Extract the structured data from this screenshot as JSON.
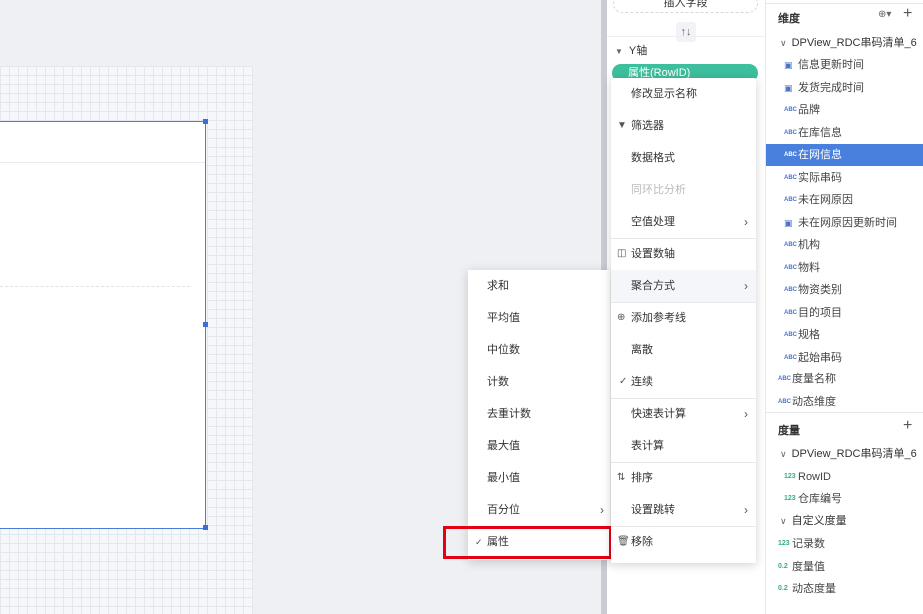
{
  "middle_panel": {
    "insert_field": "插入字段",
    "swap_icon": "↑↓",
    "yaxis_label": "Y轴",
    "pill_label": "属性(RowID)"
  },
  "context_menu": {
    "items": [
      {
        "label": "修改显示名称"
      },
      {
        "label": "筛选器",
        "icon": "filter-icon"
      },
      {
        "label": "数据格式"
      },
      {
        "label": "同环比分析"
      },
      {
        "label": "空值处理"
      },
      {
        "label": "设置数轴",
        "icon": "axis-icon"
      },
      {
        "label": "聚合方式"
      },
      {
        "label": "添加参考线",
        "icon": "add-circle-icon"
      },
      {
        "label": "离散"
      },
      {
        "label": "连续"
      },
      {
        "label": "快速表计算"
      },
      {
        "label": "表计算"
      },
      {
        "label": "排序",
        "icon": "sort-icon"
      },
      {
        "label": "设置跳转"
      },
      {
        "label": "移除",
        "icon": "trash-icon"
      }
    ]
  },
  "aggregation_submenu": {
    "items": [
      {
        "label": "求和"
      },
      {
        "label": "平均值"
      },
      {
        "label": "中位数"
      },
      {
        "label": "计数"
      },
      {
        "label": "去重计数"
      },
      {
        "label": "最大值"
      },
      {
        "label": "最小值"
      },
      {
        "label": "百分位"
      },
      {
        "label": "属性",
        "checked": true
      }
    ]
  },
  "dimensions": {
    "title": "维度",
    "group": "DPView_RDC串码清单_6",
    "items": [
      {
        "label": "信息更新时间",
        "type": "date"
      },
      {
        "label": "发货完成时间",
        "type": "date"
      },
      {
        "label": "品牌",
        "type": "abc"
      },
      {
        "label": "在库信息",
        "type": "abc"
      },
      {
        "label": "在网信息",
        "type": "abc",
        "selected": true
      },
      {
        "label": "实际串码",
        "type": "abc"
      },
      {
        "label": "未在网原因",
        "type": "abc"
      },
      {
        "label": "未在网原因更新时间",
        "type": "date"
      },
      {
        "label": "机构",
        "type": "abc"
      },
      {
        "label": "物料",
        "type": "abc"
      },
      {
        "label": "物资类别",
        "type": "abc"
      },
      {
        "label": "目的项目",
        "type": "abc"
      },
      {
        "label": "规格",
        "type": "abc"
      },
      {
        "label": "起始串码",
        "type": "abc"
      }
    ],
    "extra": [
      {
        "label": "度量名称",
        "type": "abc"
      },
      {
        "label": "动态维度",
        "type": "abc"
      }
    ]
  },
  "measures": {
    "title": "度量",
    "group": "DPView_RDC串码清单_6",
    "items": [
      {
        "label": "RowID",
        "type": "123"
      },
      {
        "label": "仓库编号",
        "type": "123"
      }
    ],
    "custom_group": "自定义度量",
    "custom_items": [
      {
        "label": "记录数",
        "type": "123"
      },
      {
        "label": "度量值",
        "type": "0.2"
      },
      {
        "label": "动态度量",
        "type": "0.2"
      }
    ]
  },
  "icons": {
    "abc": "ABC",
    "num": "123",
    "dec": "0.2",
    "date": "▣",
    "check": "✓",
    "chevron_right": "›",
    "chevron_down": "∨",
    "plus": "+",
    "globe": "⊕▾"
  }
}
